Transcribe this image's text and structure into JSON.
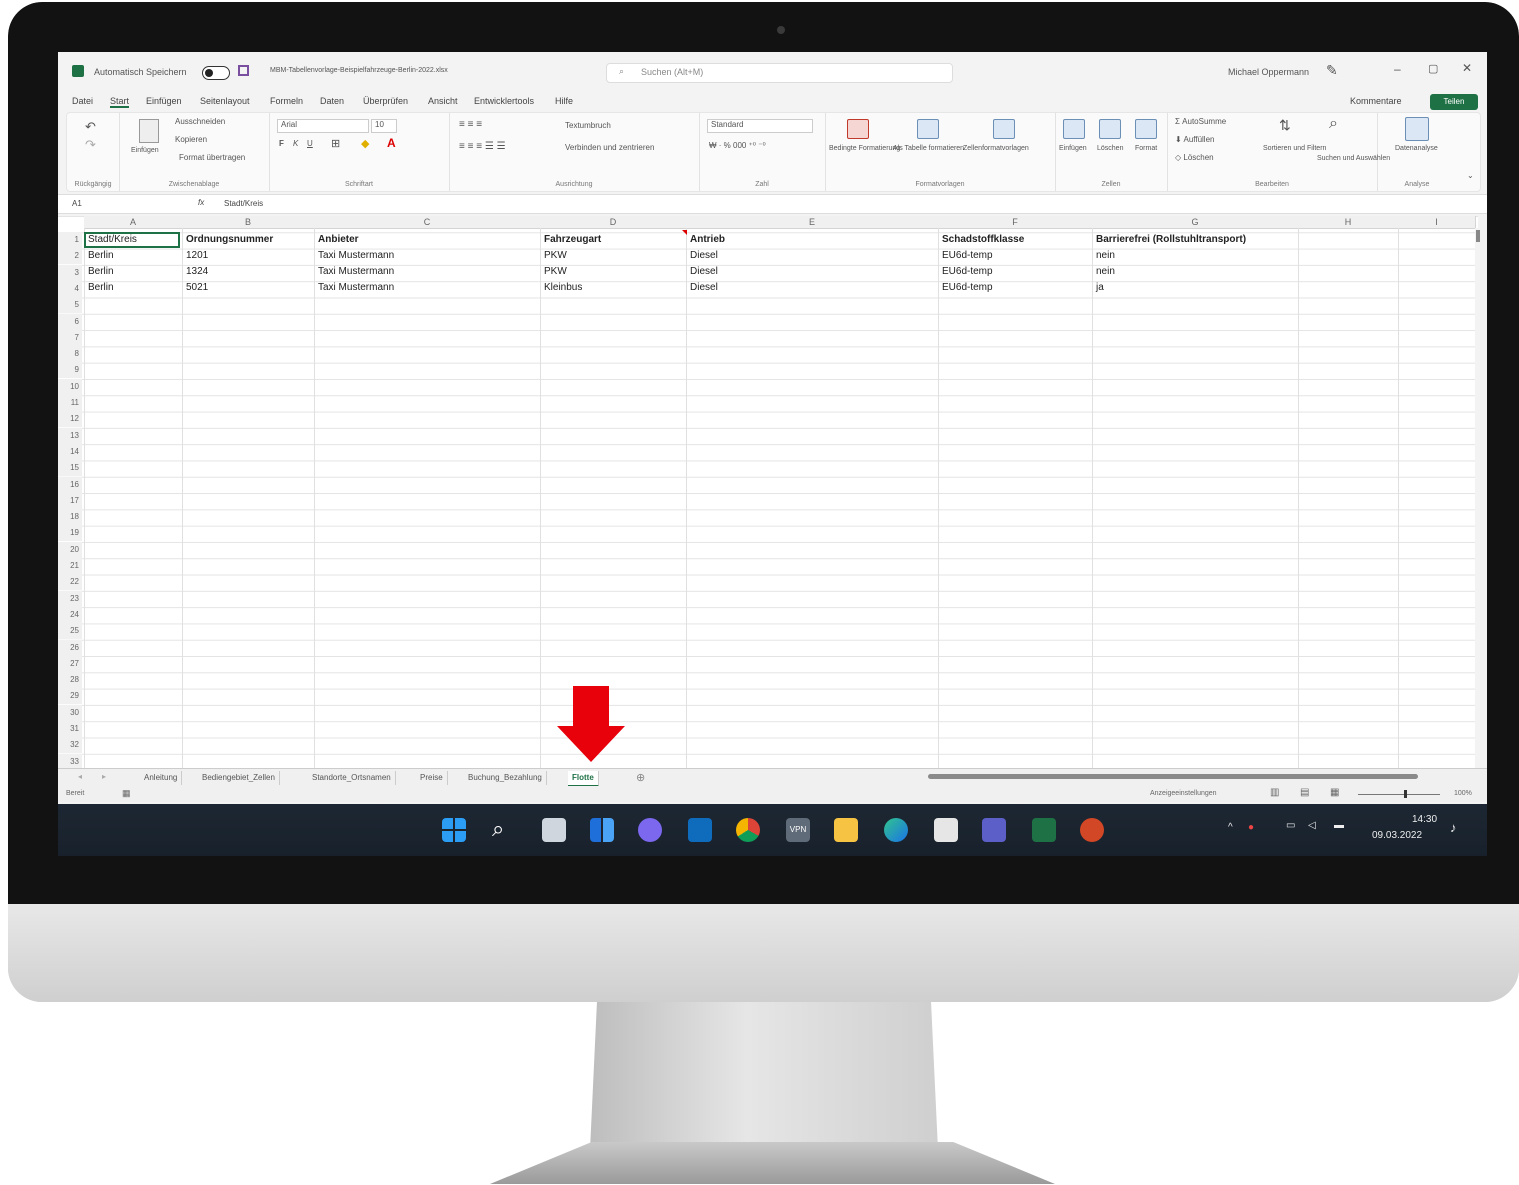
{
  "window": {
    "autosave_label": "Automatisch Speichern",
    "file_name": "MBM-Tabellenvorlage-Beispielfahrzeuge-Berlin-2022.xlsx",
    "search_placeholder": "Suchen (Alt+M)",
    "user_name": "Michael Oppermann"
  },
  "menu": {
    "tabs": [
      "Datei",
      "Start",
      "Einfügen",
      "Seitenlayout",
      "Formeln",
      "Daten",
      "Überprüfen",
      "Ansicht",
      "Entwicklertools",
      "Hilfe"
    ],
    "active_tab": "Start",
    "comments_label": "Kommentare",
    "share_label": "Teilen"
  },
  "ribbon": {
    "groups": [
      {
        "label": "Rückgängig"
      },
      {
        "label": "Zwischenablage",
        "items": [
          "Ausschneiden",
          "Kopieren",
          "Format übertragen",
          "Einfügen"
        ]
      },
      {
        "label": "Schriftart",
        "items": [
          "Arial",
          "10"
        ]
      },
      {
        "label": "Ausrichtung",
        "items": [
          "Textumbruch",
          "Verbinden und zentrieren"
        ]
      },
      {
        "label": "Zahl",
        "items": [
          "Standard"
        ]
      },
      {
        "label": "Formatvorlagen",
        "items": [
          "Bedingte Formatierung",
          "Als Tabelle formatieren",
          "Zellenformatvorlagen"
        ]
      },
      {
        "label": "Zellen",
        "items": [
          "Einfügen",
          "Löschen",
          "Format"
        ]
      },
      {
        "label": "Bearbeiten",
        "items": [
          "AutoSumme",
          "Auffüllen",
          "Löschen",
          "Sortieren und Filtern",
          "Suchen und Auswählen"
        ]
      },
      {
        "label": "Analyse",
        "items": [
          "Datenanalyse"
        ]
      }
    ]
  },
  "formula_bar": {
    "name_box": "A1",
    "fx": "fx",
    "content": "Stadt/Kreis"
  },
  "sheet": {
    "columns": [
      "A",
      "B",
      "C",
      "D",
      "E",
      "F",
      "G",
      "H",
      "I"
    ],
    "headers": [
      "Stadt/Kreis",
      "Ordnungsnummer",
      "Anbieter",
      "Fahrzeugart",
      "Antrieb",
      "Schadstoffklasse",
      "Barrierefrei (Rollstuhltransport)"
    ],
    "rows": [
      [
        "Berlin",
        "1201",
        "Taxi Mustermann",
        "PKW",
        "Diesel",
        "EU6d-temp",
        "nein"
      ],
      [
        "Berlin",
        "1324",
        "Taxi Mustermann",
        "PKW",
        "Diesel",
        "EU6d-temp",
        "nein"
      ],
      [
        "Berlin",
        "5021",
        "Taxi Mustermann",
        "Kleinbus",
        "Diesel",
        "EU6d-temp",
        "ja"
      ]
    ],
    "row_numbers": [
      "1",
      "2",
      "3",
      "4",
      "5",
      "6",
      "7",
      "8",
      "9",
      "10",
      "11",
      "12",
      "13",
      "14",
      "15",
      "16",
      "17",
      "18",
      "19",
      "20",
      "21",
      "22",
      "23",
      "24",
      "25",
      "26",
      "27",
      "28",
      "29",
      "30",
      "31",
      "32",
      "33"
    ]
  },
  "sheet_tabs": {
    "tabs": [
      "Anleitung",
      "Bediengebiet_Zellen",
      "Standorte_Ortsnamen",
      "Preise",
      "Buchung_Bezahlung",
      "Flotte"
    ],
    "active": "Flotte"
  },
  "status": {
    "mode": "Bereit",
    "display_settings": "Anzeigeeinstellungen",
    "zoom": "100%"
  },
  "taskbar": {
    "icons": [
      "windows-start",
      "search",
      "task-view",
      "widgets",
      "teams-chat",
      "outlook",
      "chrome",
      "vpn",
      "file-explorer",
      "edge",
      "notepad",
      "teams",
      "excel",
      "powerpoint"
    ],
    "time": "14:30",
    "date": "09.03.2022"
  },
  "colors": {
    "excel_green": "#1e7145",
    "arrow_red": "#e8000b",
    "taskbar": "#1d2733"
  }
}
